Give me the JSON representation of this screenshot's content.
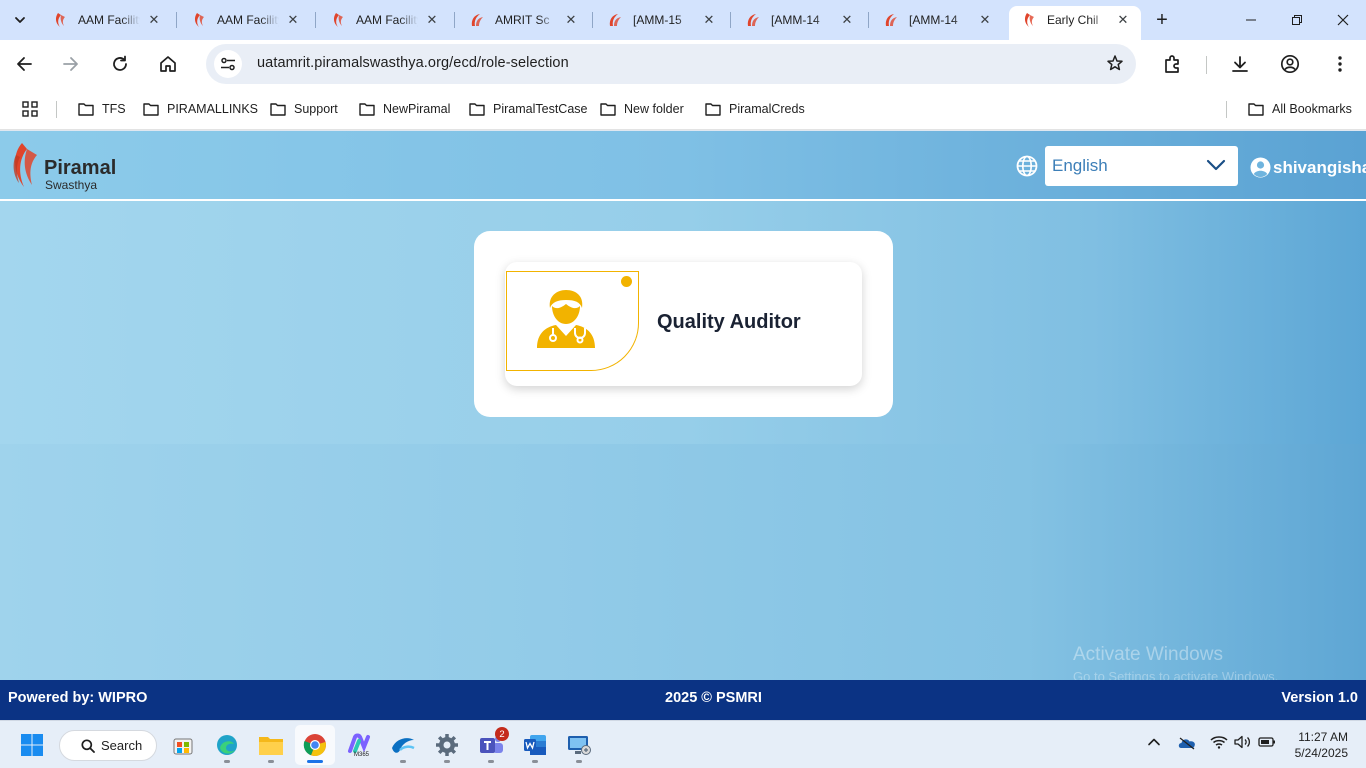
{
  "browser": {
    "tabs": [
      {
        "title": "AAM Facility",
        "favicon": "piramal-favicon",
        "active": false
      },
      {
        "title": "AAM Facility",
        "favicon": "piramal-favicon",
        "active": false
      },
      {
        "title": "AAM Facility",
        "favicon": "piramal-favicon",
        "active": false
      },
      {
        "title": "AMRIT Sc",
        "favicon": "amrit-favicon",
        "active": false
      },
      {
        "title": "[AMM-15",
        "favicon": "amrit-favicon",
        "active": false
      },
      {
        "title": "[AMM-14",
        "favicon": "amrit-favicon",
        "active": false
      },
      {
        "title": "[AMM-14",
        "favicon": "amrit-favicon",
        "active": false
      },
      {
        "title": "Early Chil",
        "favicon": "piramal-favicon",
        "active": true
      }
    ],
    "close_glyph": "✕",
    "new_tab_glyph": "+",
    "url": "uatamrit.piramalswasthya.org/ecd/role-selection",
    "bookmarks": [
      {
        "label": "TFS"
      },
      {
        "label": "PIRAMALLINKS"
      },
      {
        "label": "Support"
      },
      {
        "label": "NewPiramal"
      },
      {
        "label": "PiramalTestCase"
      },
      {
        "label": "New folder"
      },
      {
        "label": "PiramalCreds"
      }
    ],
    "all_bookmarks_label": "All Bookmarks"
  },
  "app": {
    "logo_name": "Piramal",
    "logo_sub": "Swasthya",
    "language": {
      "selected": "English"
    },
    "user": {
      "name": "shivangisha"
    },
    "roles": [
      {
        "label": "Quality Auditor",
        "icon": "doctor-icon",
        "accent": "#f2b300"
      }
    ],
    "footer": {
      "powered_by": "Powered by: WIPRO",
      "copyright": "2025 © PSMRI",
      "version": "Version 1.0"
    }
  },
  "watermark": {
    "title": "Activate Windows",
    "subtitle": "Go to Settings to activate Windows."
  },
  "taskbar": {
    "search_label": "Search",
    "teams_badge": "2",
    "time": "11:27 AM",
    "date": "5/24/2025"
  },
  "colors": {
    "tab_strip": "#d3e3fd",
    "header_blue": "#7fc0e5",
    "footer_navy": "#0b3384",
    "role_accent": "#f2b300",
    "piramal_red": "#e0452c"
  }
}
